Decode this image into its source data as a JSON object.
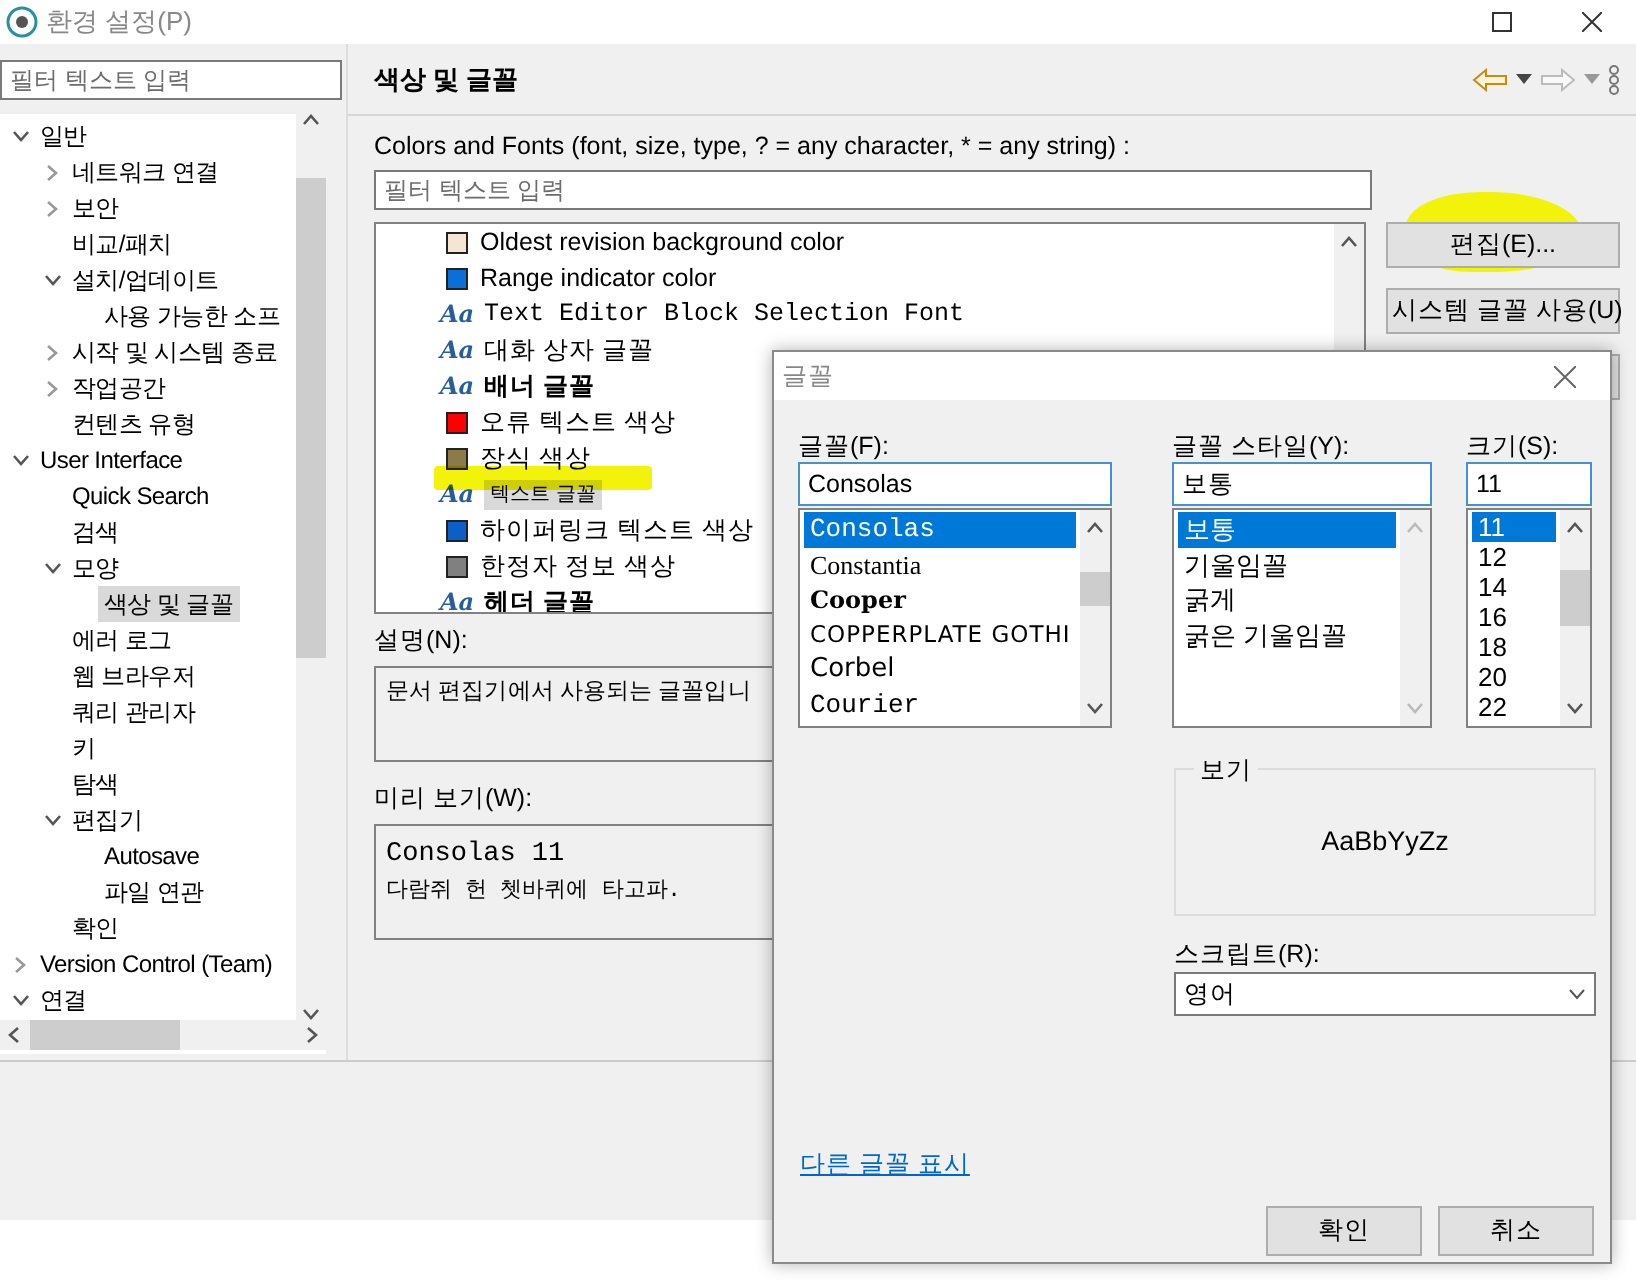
{
  "window": {
    "title": "환경 설정(P)"
  },
  "left": {
    "filter_placeholder": "필터 텍스트 입력",
    "tree": [
      {
        "label": "일반",
        "expanded": true,
        "selected": false,
        "children": [
          {
            "label": "네트워크 연결",
            "expanded": false,
            "selected": false
          },
          {
            "label": "보안",
            "expanded": false,
            "selected": false
          },
          {
            "label": "비교/패치",
            "selected": false
          },
          {
            "label": "설치/업데이트",
            "expanded": true,
            "selected": false,
            "children": [
              {
                "label": "사용 가능한 소프",
                "selected": false
              }
            ]
          },
          {
            "label": "시작 및 시스템 종료",
            "expanded": false,
            "selected": false
          },
          {
            "label": "작업공간",
            "expanded": false,
            "selected": false
          },
          {
            "label": "컨텐츠 유형",
            "selected": false
          }
        ]
      },
      {
        "label": "User Interface",
        "expanded": true,
        "selected": false,
        "children": [
          {
            "label": "Quick Search",
            "selected": false
          },
          {
            "label": "검색",
            "selected": false
          },
          {
            "label": "모양",
            "expanded": true,
            "selected": false,
            "children": [
              {
                "label": "색상 및 글꼴",
                "selected": true
              }
            ]
          },
          {
            "label": "에러 로그",
            "selected": false
          },
          {
            "label": "웹 브라우저",
            "selected": false
          },
          {
            "label": "쿼리 관리자",
            "selected": false
          },
          {
            "label": "키",
            "selected": false
          },
          {
            "label": "탐색",
            "selected": false
          },
          {
            "label": "편집기",
            "expanded": true,
            "selected": false,
            "children": [
              {
                "label": "Autosave",
                "selected": false
              },
              {
                "label": "파일 연관",
                "selected": false
              }
            ]
          },
          {
            "label": "확인",
            "selected": false
          }
        ]
      },
      {
        "label": "Version Control (Team)",
        "expanded": false,
        "selected": false
      },
      {
        "label": "연결",
        "expanded": true,
        "selected": false
      }
    ]
  },
  "page": {
    "title": "색상 및 글꼴",
    "filter_label": "Colors and Fonts (font, size, type, ? = any character, * = any string) :",
    "filter_placeholder": "필터 텍스트 입력",
    "items": [
      {
        "kind": "color",
        "label": "Oldest revision background color",
        "color": "#f5e6d3",
        "selected": false
      },
      {
        "kind": "color",
        "label": "Range indicator color",
        "color": "#0a6fd8",
        "selected": false
      },
      {
        "kind": "font-mono",
        "icon": "Aa",
        "label": "Text Editor Block Selection Font",
        "selected": false
      },
      {
        "kind": "font",
        "icon": "Aa",
        "label": "대화 상자 글꼴",
        "selected": false
      },
      {
        "kind": "font-bold",
        "icon": "Aa",
        "label": "배너 글꼴",
        "selected": false
      },
      {
        "kind": "color",
        "label": "오류 텍스트 색상",
        "color": "#ff0000",
        "selected": false
      },
      {
        "kind": "color",
        "label": "장식 색상",
        "color": "#8c7a48",
        "selected": false
      },
      {
        "kind": "font-small",
        "icon": "Aa",
        "label": "텍스트 글꼴",
        "selected": true
      },
      {
        "kind": "color",
        "label": "하이퍼링크 텍스트 색상",
        "color": "#0a5fc8",
        "selected": false
      },
      {
        "kind": "color",
        "label": "한정자 정보 색상",
        "color": "#808080",
        "selected": false
      },
      {
        "kind": "font-bold",
        "icon": "Aa",
        "label": "헤더 글꼴",
        "selected": false
      }
    ],
    "buttons": [
      "편집(E)...",
      "시스템 글꼴 사용(U)"
    ],
    "description_label": "설명(N):",
    "description": "문서 편집기에서 사용되는 글꼴입니",
    "preview_label": "미리 보기(W):",
    "preview": [
      "Consolas 11",
      "다람쥐 헌 쳇바퀴에 타고파."
    ]
  },
  "font_dialog": {
    "title": "글꼴",
    "font": {
      "label": "글꼴(F):",
      "value": "Consolas",
      "options": [
        {
          "label": "Consolas",
          "kind": "mono",
          "selected": true
        },
        {
          "label": "Constantia",
          "kind": "serif",
          "selected": false
        },
        {
          "label": "Cooper",
          "kind": "bold-serif",
          "selected": false
        },
        {
          "label": "COPPERPLATE GOTHI",
          "kind": "wide",
          "selected": false
        },
        {
          "label": "Corbel",
          "kind": "sans",
          "selected": false
        },
        {
          "label": "Courier",
          "kind": "mono",
          "selected": false
        }
      ]
    },
    "style": {
      "label": "글꼴 스타일(Y):",
      "value": "보통",
      "options": [
        {
          "label": "보통",
          "selected": true
        },
        {
          "label": "기울임꼴",
          "selected": false
        },
        {
          "label": "굵게",
          "selected": false
        },
        {
          "label": "굵은 기울임꼴",
          "selected": false
        }
      ]
    },
    "size": {
      "label": "크기(S):",
      "value": "11",
      "options": [
        {
          "label": "11",
          "selected": true
        },
        {
          "label": "12",
          "selected": false
        },
        {
          "label": "14",
          "selected": false
        },
        {
          "label": "16",
          "selected": false
        },
        {
          "label": "18",
          "selected": false
        },
        {
          "label": "20",
          "selected": false
        },
        {
          "label": "22",
          "selected": false
        }
      ]
    },
    "sample_label": "보기",
    "sample": "AaBbYyZz",
    "script_label": "스크립트(R):",
    "script_value": "영어",
    "more_fonts_link": "다른 글꼴 표시",
    "buttons": [
      "확인",
      "취소"
    ]
  },
  "highlights": [
    {
      "kind": "blob"
    },
    {
      "kind": "stroke"
    }
  ]
}
